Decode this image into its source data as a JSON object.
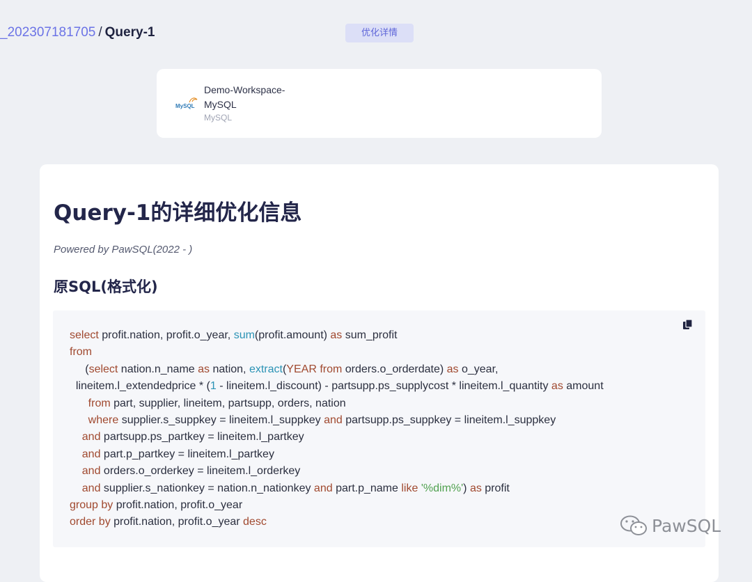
{
  "breadcrumb": {
    "parent": "_202307181705",
    "separator": "/",
    "current": "Query-1"
  },
  "tab": {
    "label": "优化详情"
  },
  "workspace": {
    "name": "Demo-Workspace-MySQL",
    "type": "MySQL",
    "logo_text": "MySQL"
  },
  "doc": {
    "title": "Query-1的详细优化信息",
    "powered_by": "Powered by PawSQL(2022 - )",
    "section_title": "原SQL(格式化)"
  },
  "code": {
    "copy_icon": "copy-icon",
    "lines": [
      [
        [
          "kw",
          "select"
        ],
        [
          "t",
          " profit.nation, profit.o_year, "
        ],
        [
          "fn",
          "sum"
        ],
        [
          "t",
          "(profit.amount) "
        ],
        [
          "kw",
          "as"
        ],
        [
          "t",
          " sum_profit"
        ]
      ],
      [
        [
          "kw",
          "from"
        ]
      ],
      [
        [
          "t",
          "     ("
        ],
        [
          "kw",
          "select"
        ],
        [
          "t",
          " nation.n_name "
        ],
        [
          "kw",
          "as"
        ],
        [
          "t",
          " nation, "
        ],
        [
          "fn",
          "extract"
        ],
        [
          "t",
          "("
        ],
        [
          "kw",
          "YEAR from"
        ],
        [
          "t",
          " orders.o_orderdate) "
        ],
        [
          "kw",
          "as"
        ],
        [
          "t",
          " o_year,"
        ]
      ],
      [
        [
          "t",
          "  lineitem.l_extendedprice * ("
        ],
        [
          "num",
          "1"
        ],
        [
          "t",
          " - lineitem.l_discount) - partsupp.ps_supplycost * lineitem.l_quantity "
        ],
        [
          "kw",
          "as"
        ],
        [
          "t",
          " amount"
        ]
      ],
      [
        [
          "t",
          "      "
        ],
        [
          "kw",
          "from"
        ],
        [
          "t",
          " part, supplier, lineitem, partsupp, orders, nation"
        ]
      ],
      [
        [
          "t",
          "      "
        ],
        [
          "kw",
          "where"
        ],
        [
          "t",
          " supplier.s_suppkey = lineitem.l_suppkey "
        ],
        [
          "kw",
          "and"
        ],
        [
          "t",
          " partsupp.ps_suppkey = lineitem.l_suppkey"
        ]
      ],
      [
        [
          "t",
          "    "
        ],
        [
          "kw",
          "and"
        ],
        [
          "t",
          " partsupp.ps_partkey = lineitem.l_partkey"
        ]
      ],
      [
        [
          "t",
          "    "
        ],
        [
          "kw",
          "and"
        ],
        [
          "t",
          " part.p_partkey = lineitem.l_partkey"
        ]
      ],
      [
        [
          "t",
          "    "
        ],
        [
          "kw",
          "and"
        ],
        [
          "t",
          " orders.o_orderkey = lineitem.l_orderkey"
        ]
      ],
      [
        [
          "t",
          "    "
        ],
        [
          "kw",
          "and"
        ],
        [
          "t",
          " supplier.s_nationkey = nation.n_nationkey "
        ],
        [
          "kw",
          "and"
        ],
        [
          "t",
          " part.p_name "
        ],
        [
          "kw",
          "like"
        ],
        [
          "t",
          " "
        ],
        [
          "str",
          "'%dim%'"
        ],
        [
          "t",
          ") "
        ],
        [
          "kw",
          "as"
        ],
        [
          "t",
          " profit"
        ]
      ],
      [
        [
          "kw",
          "group by"
        ],
        [
          "t",
          " profit.nation, profit.o_year"
        ]
      ],
      [
        [
          "kw",
          "order by"
        ],
        [
          "t",
          " profit.nation, profit.o_year "
        ],
        [
          "kw",
          "desc"
        ]
      ]
    ]
  },
  "watermark": {
    "text": "PawSQL",
    "icon": "wechat-icon"
  },
  "colors": {
    "accent": "#6b73e6",
    "keyword": "#a0492f",
    "function": "#2b93b5",
    "string": "#50a14f",
    "background": "#eef0f4"
  }
}
